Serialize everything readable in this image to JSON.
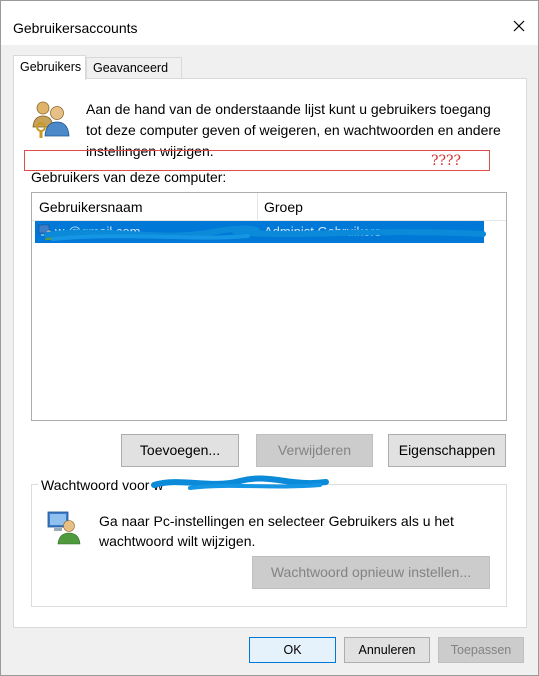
{
  "window": {
    "title": "Gebruikersaccounts"
  },
  "tabs": [
    {
      "label": "Gebruikers",
      "active": true
    },
    {
      "label": "Geavanceerd",
      "active": false
    }
  ],
  "intro": {
    "text": "Aan de hand van de onderstaande lijst kunt u gebruikers toegang tot deze computer geven of weigeren, en wachtwoorden en andere instellingen wijzigen.",
    "icon": "users-icon"
  },
  "annotation": {
    "text": "????"
  },
  "users_list": {
    "label": "Gebruikers van deze computer:",
    "columns": [
      "Gebruikersnaam",
      "Groep"
    ],
    "rows": [
      {
        "name": "w        @gmail.com",
        "group": "Administ        Gebruikers",
        "selected": true
      }
    ]
  },
  "buttons": {
    "add": "Toevoegen...",
    "remove": "Verwijderen",
    "properties": "Eigenschappen"
  },
  "password_group": {
    "legend": "Wachtwoord voor w",
    "text": "Ga naar Pc-instellingen en selecteer Gebruikers als u het wachtwoord wilt wijzigen.",
    "reset_button": "Wachtwoord opnieuw instellen..."
  },
  "footer": {
    "ok": "OK",
    "cancel": "Annuleren",
    "apply": "Toepassen"
  },
  "colors": {
    "selection": "#0078d7",
    "annotation": "#d8312f",
    "scribble": "#0a8ad8"
  }
}
